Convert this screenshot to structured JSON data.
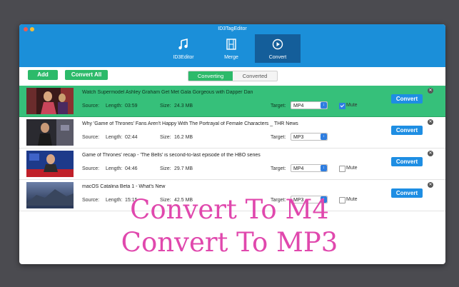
{
  "window": {
    "title": "ID3TagEditor"
  },
  "toolbar": {
    "items": [
      {
        "label": "ID3Editor",
        "icon": "music-note-icon"
      },
      {
        "label": "Merge",
        "icon": "film-icon"
      },
      {
        "label": "Convert",
        "icon": "play-circle-icon"
      }
    ],
    "active": "Convert"
  },
  "actions": {
    "add_label": "Add",
    "convert_all_label": "Convert All"
  },
  "tabs": {
    "converting": "Converting",
    "converted": "Converted",
    "selected": "Converting"
  },
  "labels": {
    "source": "Source:",
    "length": "Length:",
    "size": "Size:",
    "target": "Target:",
    "mute": "Mute",
    "convert": "Convert"
  },
  "files": [
    {
      "title": "Watch Supermodel Ashley Graham Get Met Gala Gorgeous with Dapper Dan",
      "length": "03:59",
      "size": "24.3 MB",
      "target": "MP4",
      "mute": true,
      "selected": true
    },
    {
      "title": "Why 'Game of Thrones' Fans Aren't Happy With The Portrayal of Female Characters _ THR News",
      "length": "02:44",
      "size": "16.2 MB",
      "target": "MP3",
      "mute": false,
      "selected": false
    },
    {
      "title": "Game of Thrones' recap - 'The Bells' is second-to-last episode of the HBO series",
      "length": "04:46",
      "size": "29.7 MB",
      "target": "MP4",
      "mute": false,
      "selected": false
    },
    {
      "title": "macOS Catalina Beta 1 - What's New",
      "length": "15:15",
      "size": "42.5 MB",
      "target": "MP3",
      "mute": false,
      "selected": false
    }
  ],
  "overlay": {
    "line1": "Convert To M4",
    "line2": "Convert To MP3"
  },
  "colors": {
    "accent": "#1b8fd9",
    "green": "#2cba6a",
    "overlay": "#e048ad"
  }
}
